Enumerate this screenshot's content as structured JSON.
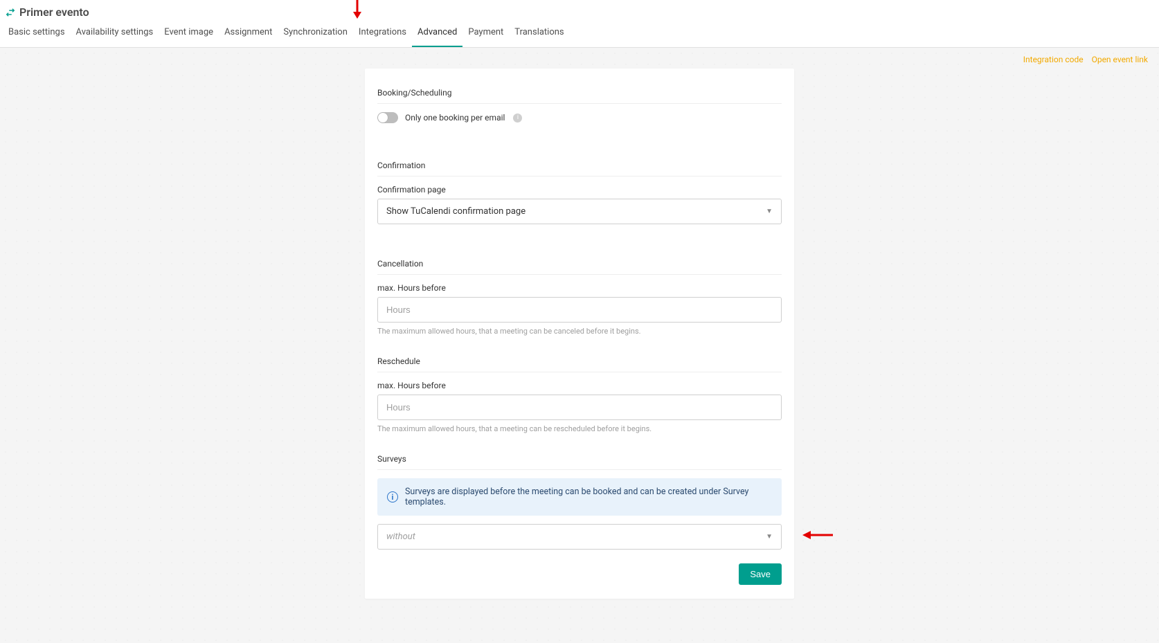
{
  "header": {
    "title": "Primer evento",
    "tabs": [
      {
        "label": "Basic settings"
      },
      {
        "label": "Availability settings"
      },
      {
        "label": "Event image"
      },
      {
        "label": "Assignment"
      },
      {
        "label": "Synchronization"
      },
      {
        "label": "Integrations"
      },
      {
        "label": "Advanced",
        "active": true
      },
      {
        "label": "Payment"
      },
      {
        "label": "Translations"
      }
    ],
    "links": {
      "integration_code": "Integration code",
      "open_event_link": "Open event link"
    }
  },
  "sections": {
    "booking": {
      "title": "Booking/Scheduling",
      "toggle_label": "Only one booking per email"
    },
    "confirmation": {
      "title": "Confirmation",
      "field_label": "Confirmation page",
      "value": "Show TuCalendi confirmation page"
    },
    "cancellation": {
      "title": "Cancellation",
      "field_label": "max. Hours before",
      "placeholder": "Hours",
      "helper": "The maximum allowed hours, that a meeting can be canceled before it begins."
    },
    "reschedule": {
      "title": "Reschedule",
      "field_label": "max. Hours before",
      "placeholder": "Hours",
      "helper": "The maximum allowed hours, that a meeting can be rescheduled before it begins."
    },
    "surveys": {
      "title": "Surveys",
      "banner": "Surveys are displayed before the meeting can be booked and can be created under Survey templates.",
      "value": "without"
    }
  },
  "buttons": {
    "save": "Save"
  }
}
